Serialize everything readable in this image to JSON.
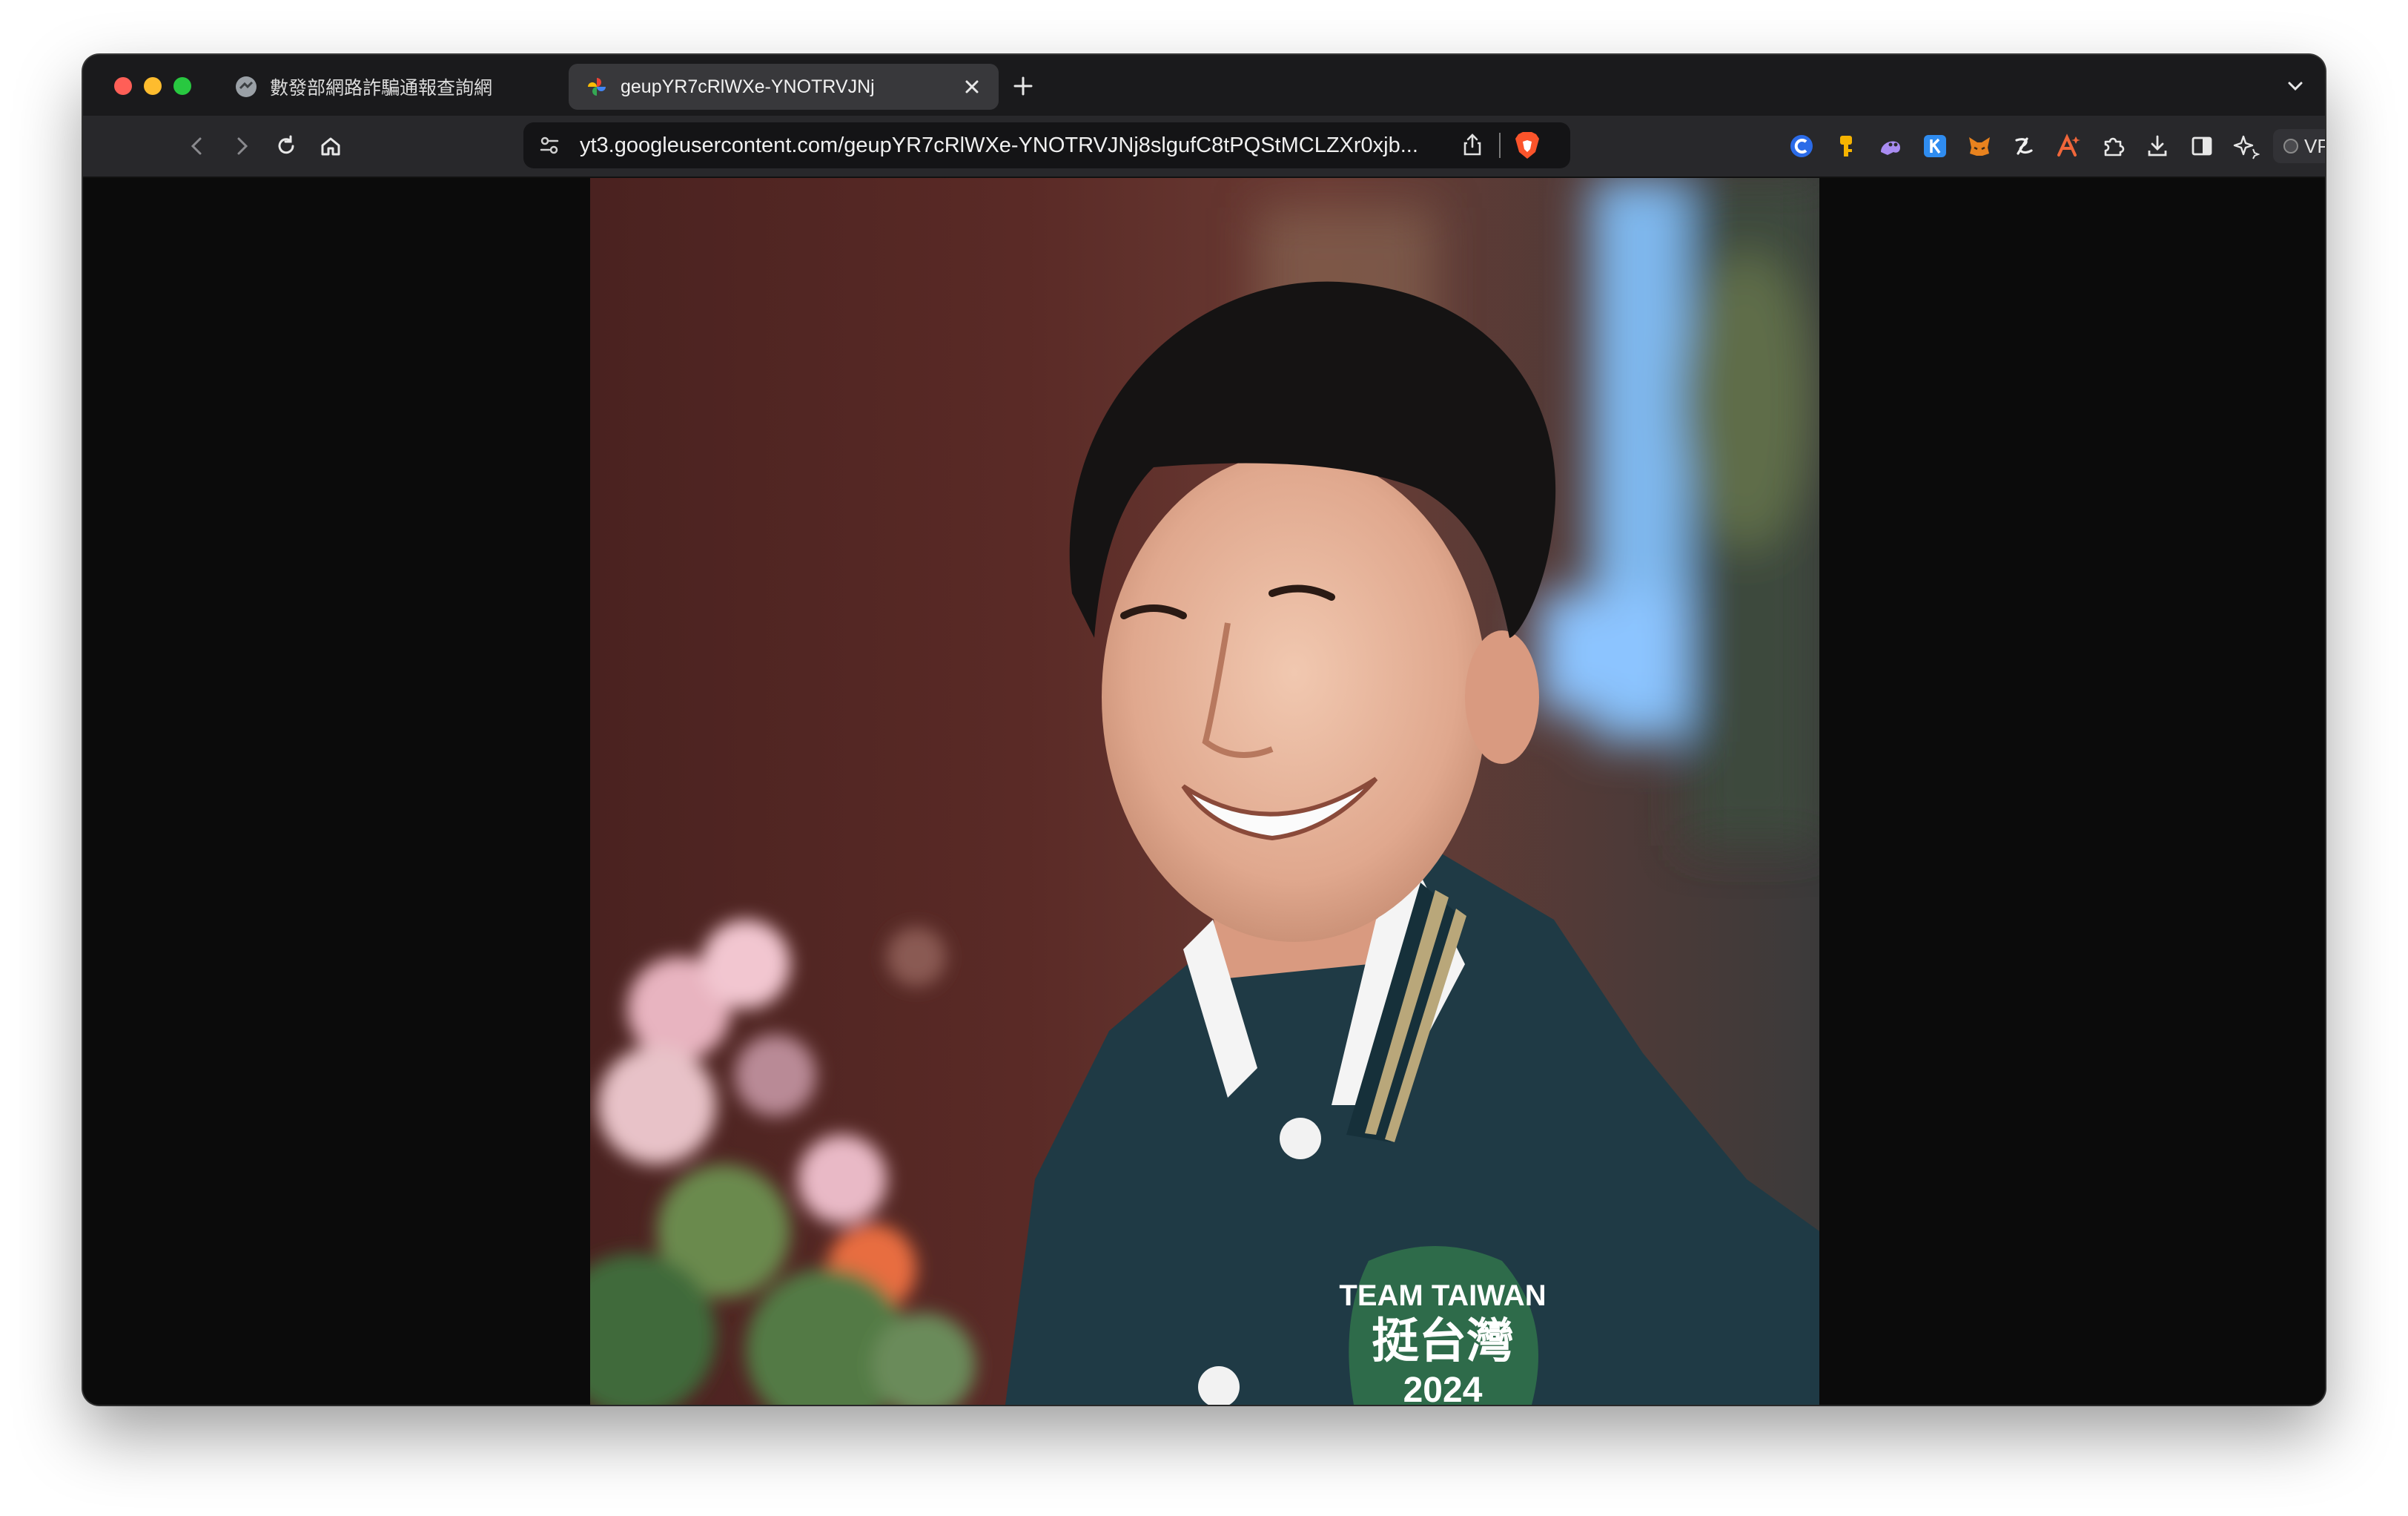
{
  "tabs": [
    {
      "title": "數發部網路詐騙通報查詢網",
      "active": false,
      "favicon": "site-favicon"
    },
    {
      "title": "geupYR7cRlWXe-YNOTRVJNj",
      "active": true,
      "favicon": "google-photos-favicon"
    }
  ],
  "toolbar": {
    "url": "yt3.googleusercontent.com/geupYR7cRlWXe-YNOTRVJNj8slgufC8tPQStMCLZXr0xjb...",
    "vpn_label": "VPN"
  },
  "image": {
    "description_icon": "portrait-photo",
    "patch_text_top": "TEAM TAIWAN",
    "patch_text_middle": "挺台灣",
    "patch_text_bottom": "2024"
  },
  "colors": {
    "traffic_red": "#ff5f57",
    "traffic_yellow": "#febc2e",
    "traffic_green": "#28c840",
    "brave_orange": "#fb542b",
    "jacket": "#1f3a45",
    "patch_green": "#2e6b4a"
  }
}
